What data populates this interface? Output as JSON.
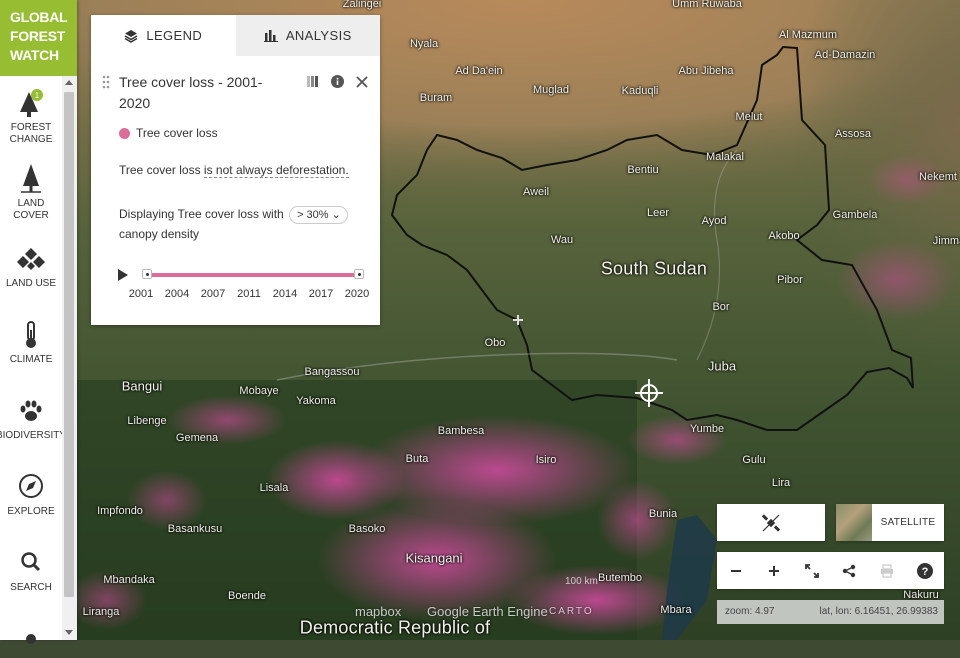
{
  "brand": {
    "line1": "GLOBAL",
    "line2": "FOREST",
    "line3": "WATCH"
  },
  "nav": [
    {
      "id": "forest-change",
      "label": "FOREST CHANGE",
      "badge": "1"
    },
    {
      "id": "land-cover",
      "label": "LAND COVER"
    },
    {
      "id": "land-use",
      "label": "LAND USE"
    },
    {
      "id": "climate",
      "label": "CLIMATE"
    },
    {
      "id": "biodiversity",
      "label": "BIODIVERSITY"
    },
    {
      "id": "explore",
      "label": "EXPLORE"
    },
    {
      "id": "search",
      "label": "SEARCH"
    }
  ],
  "panel": {
    "tabs": {
      "legend": "LEGEND",
      "analysis": "ANALYSIS"
    },
    "layer_title": "Tree cover loss - 2001-2020",
    "legend_item": "Tree cover loss",
    "note_prefix": "Tree cover loss ",
    "note_link": "is not always deforestation.",
    "density_prefix": "Displaying Tree cover loss with",
    "density_value": "> 30%",
    "density_suffix": "canopy density",
    "timeline": {
      "years": [
        "2001",
        "2004",
        "2007",
        "2011",
        "2014",
        "2017",
        "2020"
      ],
      "start": 2001,
      "end": 2020
    }
  },
  "colors": {
    "brand": "#97be32",
    "loss": "#dc6c9a",
    "border": "#111111"
  },
  "map": {
    "country_label": "South Sudan",
    "places": [
      "Zalingei",
      "Umm Ruwaba",
      "Nyala",
      "Ad Da'ein",
      "Abu Jibeha",
      "Al Mazmum",
      "Ad-Damazin",
      "Buram",
      "Muglad",
      "Kaduqli",
      "Melut",
      "Assosa",
      "Malakal",
      "Nekemt",
      "Bentiu",
      "Aweil",
      "Gambela",
      "Leer",
      "Ayod",
      "Wau",
      "Akobo",
      "Jimma",
      "Pibor",
      "Bor",
      "Obo",
      "Juba",
      "Bangui",
      "Bangassou",
      "Mobaye",
      "Yakoma",
      "Libenge",
      "Gemena",
      "Bambesa",
      "Yumbe",
      "Buta",
      "Isiro",
      "Gulu",
      "Lira",
      "Lisala",
      "Impfondo",
      "Bunia",
      "Basankusu",
      "Basoko",
      "Kisangani",
      "Mbandaka",
      "Butembo",
      "Boende",
      "Liranga",
      "Mbara",
      "Nakuru",
      "Democratic Republic of"
    ]
  },
  "controls": {
    "basemap_label": "SATELLITE"
  },
  "status": {
    "zoom_label": "zoom:",
    "zoom_value": "4.97",
    "latlon_label": "lat, lon:",
    "latlon_value": "6.16451, 26.99383"
  },
  "attribution": {
    "mapbox": "mapbox",
    "gee": "Google Earth Engine",
    "carto": "CARTO",
    "scale": "100 km"
  }
}
